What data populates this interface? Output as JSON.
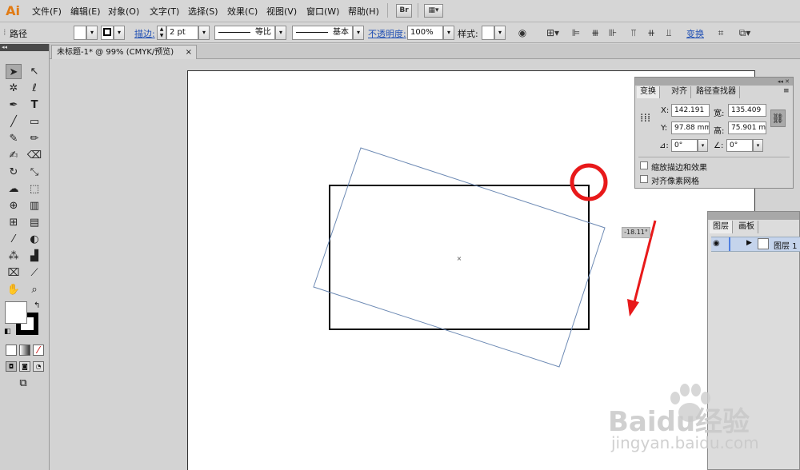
{
  "app": {
    "logo": "Ai"
  },
  "menubar": {
    "items": [
      "文件(F)",
      "编辑(E)",
      "对象(O)",
      "文字(T)",
      "选择(S)",
      "效果(C)",
      "视图(V)",
      "窗口(W)",
      "帮助(H)"
    ],
    "bridge_label": "Br"
  },
  "controlbar": {
    "selection_label": "路径",
    "stroke_label": "描边:",
    "stroke_value": "2 pt",
    "profile_label": "等比",
    "brush_label": "基本",
    "opacity_label": "不透明度:",
    "opacity_value": "100%",
    "style_label": "样式:",
    "transform_link": "变换"
  },
  "document": {
    "tab_title": "未标题-1* @ 99% (CMYK/预览)",
    "close_glyph": "×"
  },
  "canvas": {
    "rotation_tooltip": "-18.11°"
  },
  "transform_panel": {
    "tabs": [
      "变换",
      "对齐",
      "路径查找器"
    ],
    "x_label": "X:",
    "x_value": "142.191",
    "width_label": "宽:",
    "width_value": "135.409",
    "y_label": "Y:",
    "y_value": "97.88 mm",
    "height_label": "高:",
    "height_value": "75.901 m",
    "angle_value": "0°",
    "shear_value": "0°",
    "scale_strokes_label": "缩放描边和效果",
    "align_pixel_label": "对齐像素网格"
  },
  "layers_panel": {
    "tabs": [
      "图层",
      "画板"
    ],
    "layer_name": "图层 1"
  },
  "watermark": {
    "brand": "Baidu经验",
    "url": "jingyan.baidu.com"
  },
  "colors": {
    "annotation_red": "#e8191a",
    "rotation_guide": "#6d8ab4",
    "brand_orange": "#e17b14"
  }
}
